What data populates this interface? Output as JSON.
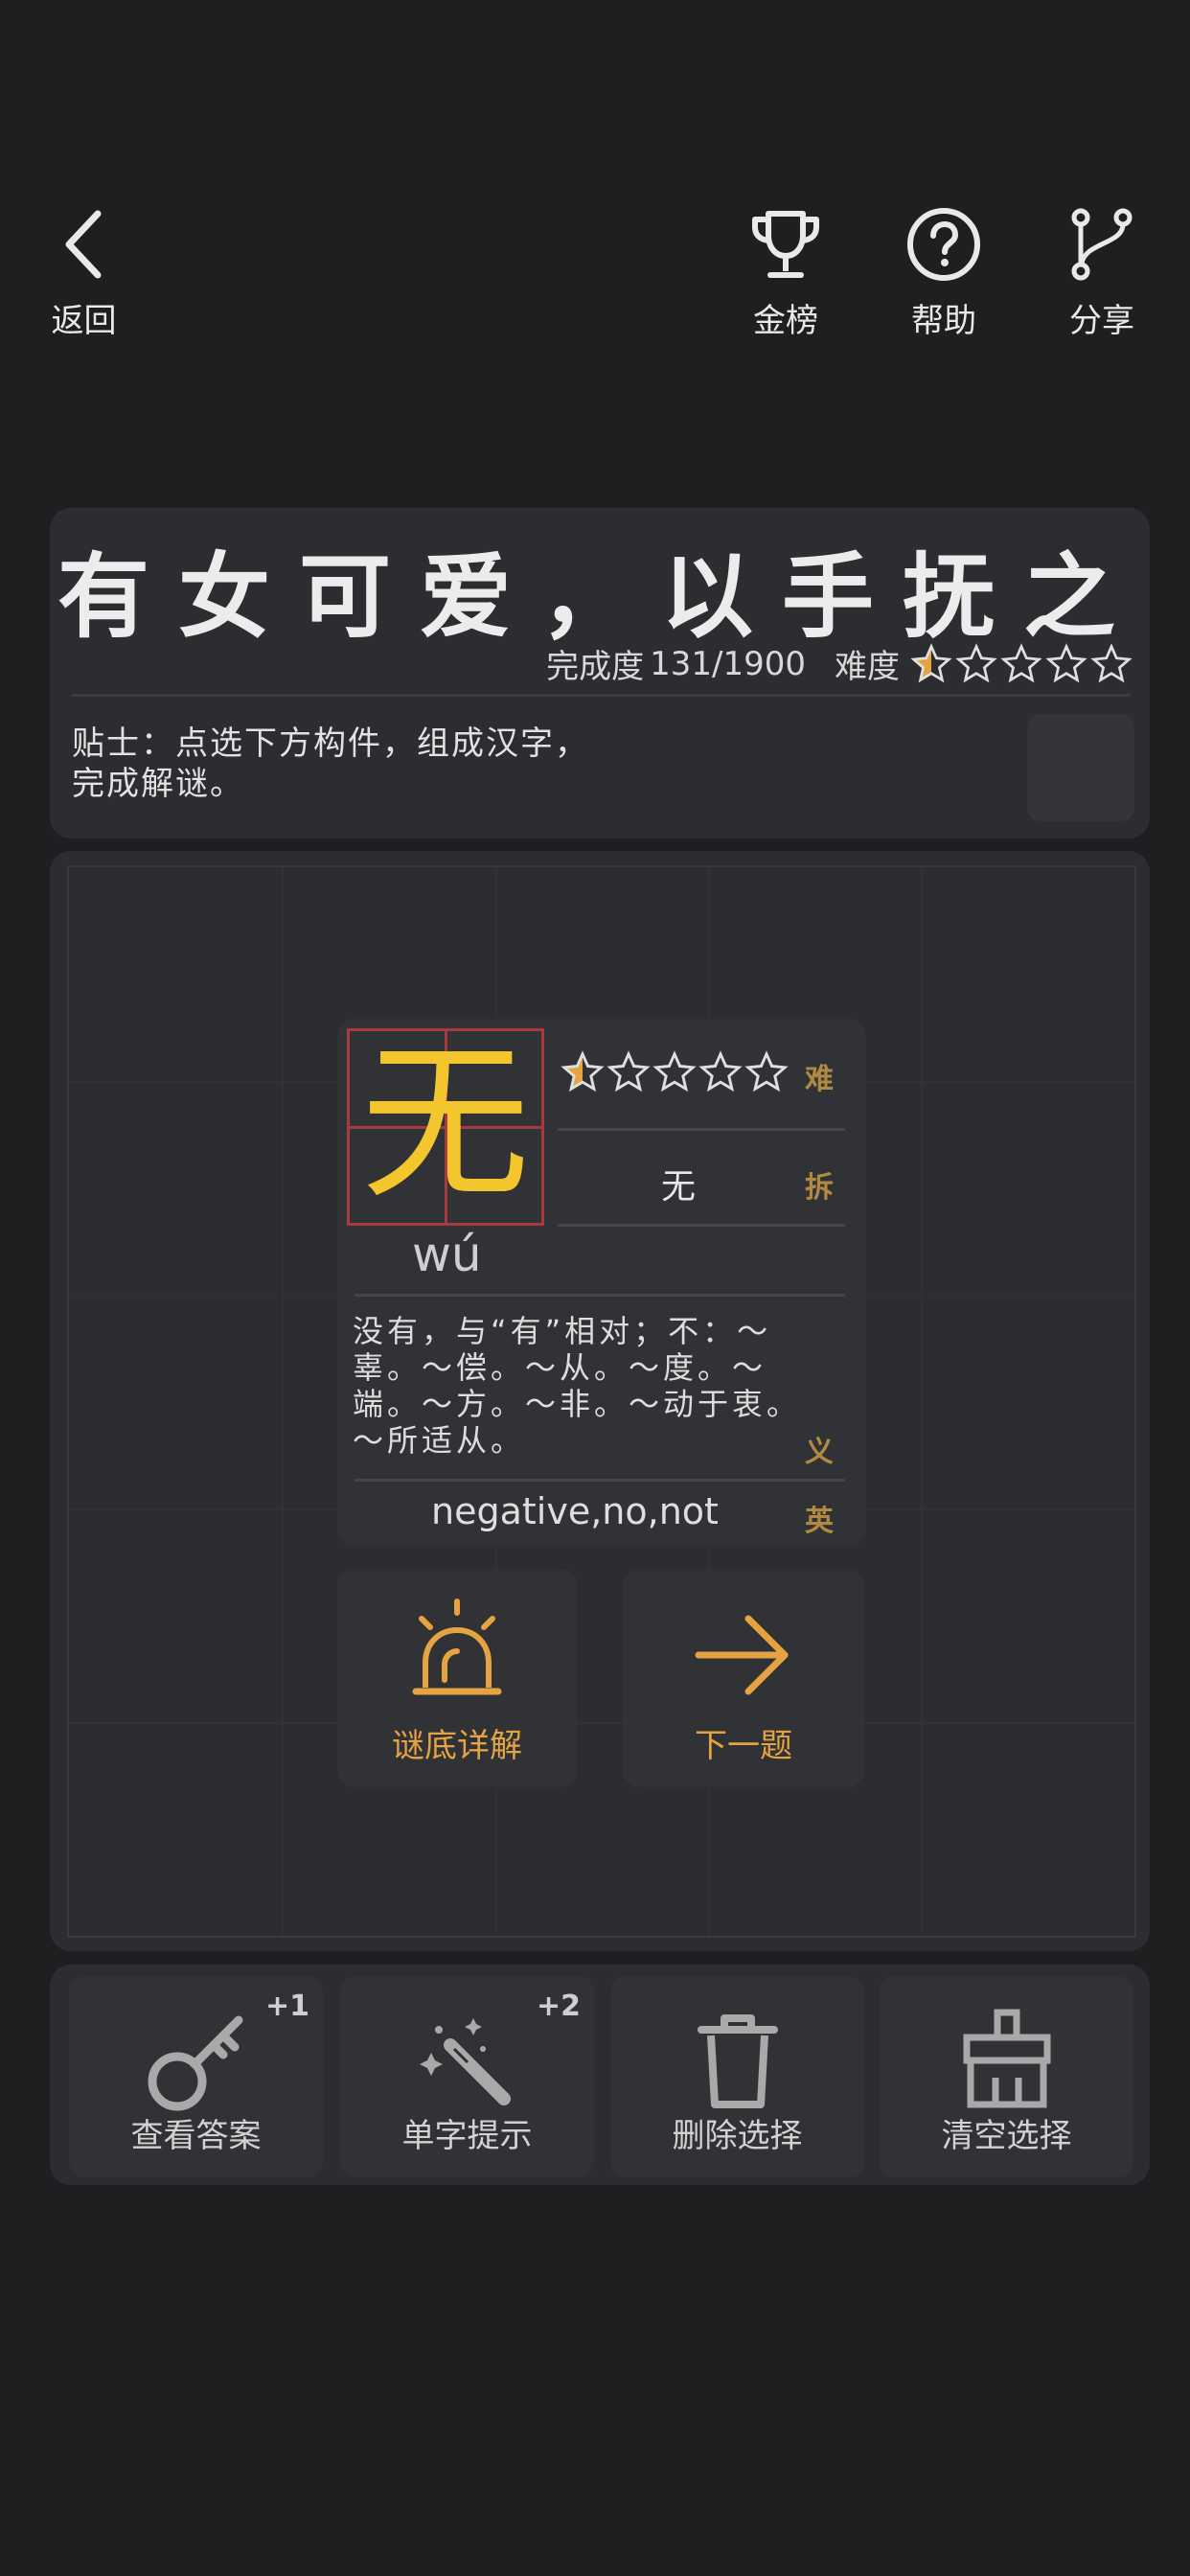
{
  "topbar": {
    "back_label": "返回",
    "leaderboard_label": "金榜",
    "help_label": "帮助",
    "share_label": "分享"
  },
  "puzzle": {
    "riddle": "有女可爱，以手抚之",
    "progress_label": "完成度",
    "progress_value": "131/1900",
    "difficulty_label": "难度",
    "difficulty_stars": 0.5,
    "difficulty_max": 5,
    "tip": [
      "贴士：点选下方构件，组成汉字，",
      "完成解谜。"
    ]
  },
  "answer_card": {
    "character": "无",
    "pinyin": "wú",
    "difficulty_stars": 0.5,
    "difficulty_tag": "难",
    "components": "无",
    "components_tag": "拆",
    "meaning": "没有，与“有”相对；不：～辜。～偿。～从。～度。～端。～方。～非。～动于衷。～所适从。",
    "meaning_tag": "义",
    "english": "negative,no,not",
    "english_tag": "英"
  },
  "actions": {
    "explain_label": "谜底详解",
    "next_label": "下一题"
  },
  "tools": [
    {
      "label": "查看答案",
      "badge": "+1",
      "icon": "key-icon"
    },
    {
      "label": "单字提示",
      "badge": "+2",
      "icon": "magic-wand-icon"
    },
    {
      "label": "删除选择",
      "badge": "",
      "icon": "trash-icon"
    },
    {
      "label": "清空选择",
      "badge": "",
      "icon": "broom-icon"
    }
  ],
  "colors": {
    "background": "#1e1f21",
    "panel": "#2c2d30",
    "accent": "#e5a341",
    "character": "#f3c62e",
    "tianzige": "#a83a3f",
    "star_fill": "#e5a341"
  }
}
